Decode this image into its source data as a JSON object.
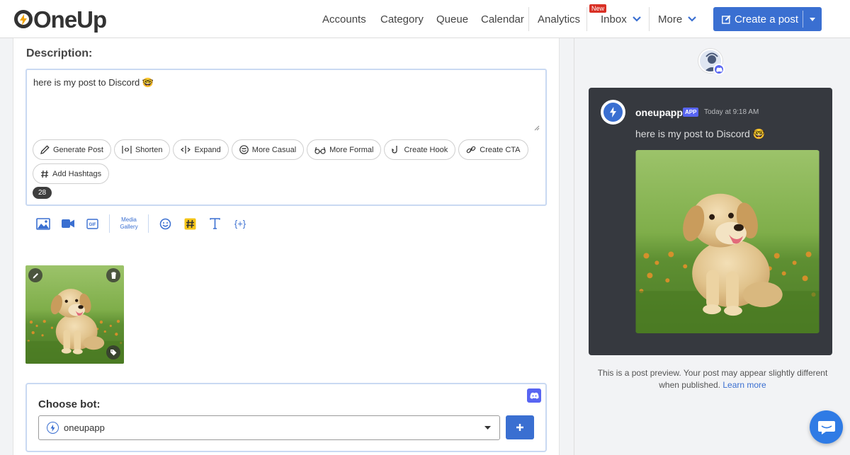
{
  "app": {
    "logo_text": "OneUp"
  },
  "nav": {
    "items": [
      "Accounts",
      "Category",
      "Queue",
      "Calendar",
      "Analytics"
    ],
    "inbox": {
      "label": "Inbox",
      "badge": "New"
    },
    "more": "More",
    "create_post": "Create a post"
  },
  "editor": {
    "description_label": "Description:",
    "post_text": "here is my post to Discord 🤓",
    "char_count": "28",
    "ai_buttons": [
      "Generate Post",
      "Shorten",
      "Expand",
      "More Casual",
      "More Formal",
      "Create Hook",
      "Create CTA",
      "Add Hashtags"
    ],
    "toolbar": {
      "image_icon": "image-icon",
      "video_icon": "video-icon",
      "gif_icon": "gif-icon",
      "media_gallery_line1": "Media",
      "media_gallery_line2": "Gallery",
      "emoji_icon": "emoji-icon",
      "hashtag_icon": "hashtag-icon",
      "text_icon": "text-format-icon",
      "variables_icon": "variables-icon"
    }
  },
  "bot": {
    "label": "Choose bot:",
    "selected": "oneupapp"
  },
  "preview": {
    "bot_name": "oneupapp",
    "app_tag": "APP",
    "timestamp": "Today at 9:18 AM",
    "message": "here is my post to Discord 🤓",
    "note": "This is a post preview. Your post may appear slightly different when published.",
    "learn_more": "Learn more"
  },
  "colors": {
    "accent": "#3a6fd1",
    "discord": "#5865f2",
    "discord_bg": "#36393f",
    "badge_red": "#d93025"
  }
}
